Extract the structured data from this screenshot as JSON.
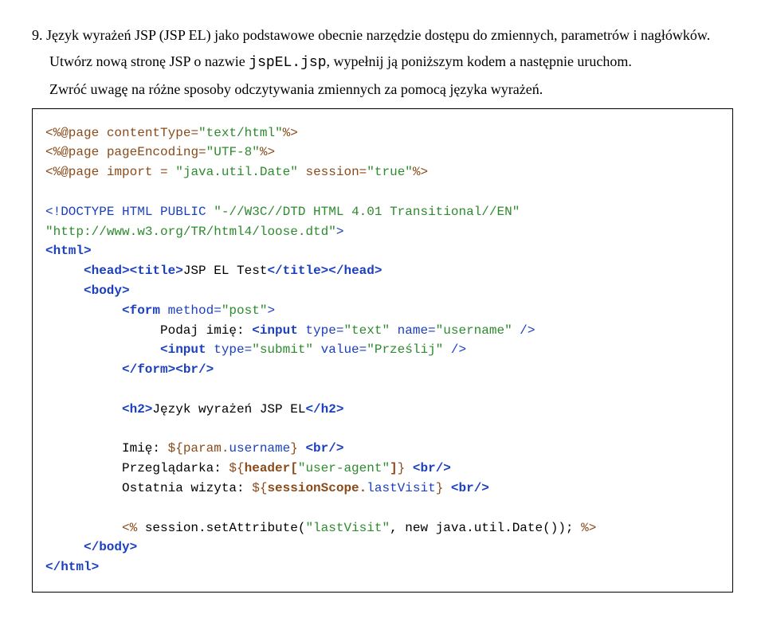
{
  "task": {
    "number": "9.",
    "line1": "Język wyrażeń JSP (JSP EL) jako podstawowe obecnie narzędzie dostępu do zmiennych, parametrów i nagłówków.",
    "line2a": "Utwórz nową stronę JSP o nazwie ",
    "line2_code": "jspEL.jsp",
    "line2b": ", wypełnij ją poniższym kodem a następnie uruchom.",
    "line3": "Zwróć uwagę na różne sposoby odczytywania zmiennych za pomocą języka wyrażeń."
  },
  "code": {
    "p_page": "<%@page",
    "p_ct": " contentType=",
    "v_ct": "\"text/html\"",
    "p_close": "%>",
    "p_enc": " pageEncoding=",
    "v_enc": "\"UTF-8\"",
    "p_imp": " import = ",
    "v_imp": "\"java.util.Date\"",
    "p_ses": " session=",
    "v_ses": "\"true\"",
    "doctype1": "<!DOCTYPE HTML PUBLIC ",
    "doctype_v1": "\"-//W3C//DTD HTML 4.01 Transitional//EN\"",
    "doctype_v2": "\"http://www.w3.org/TR/html4/loose.dtd\"",
    "doctype_close": ">",
    "html_o": "<html>",
    "head_o": "<head><title>",
    "title_txt": "JSP EL Test",
    "head_c": "</title></head>",
    "body_o": "<body>",
    "form_o": "<form",
    "form_attr": " method=",
    "form_val": "\"post\"",
    "form_end": ">",
    "podaj": "Podaj imię: ",
    "input_o": "<input",
    "typeattr": " type=",
    "typetext": "\"text\"",
    "nameattr": " name=",
    "nameval": "\"username\"",
    "selfclose": " />",
    "typesub": "\"submit\"",
    "valattr": " value=",
    "valprz": "\"Prześlij\"",
    "form_c": "</form><br/>",
    "h2_o": "<h2>",
    "h2_txt": "Język wyrażeń JSP EL",
    "h2_c": "</h2>",
    "imie_lbl": "Imię: ",
    "imie_expr": "${param.",
    "imie_user": "username",
    "imie_close": "}",
    "br": " <br/>",
    "przeg_lbl": "Przeglądarka: ",
    "przeg_expr1": "${",
    "przeg_hdr": "header[",
    "przeg_ua": "\"user-agent\"",
    "przeg_hdr2": "]",
    "przeg_close": "}",
    "ost_lbl": "Ostatnia wizyta: ",
    "ost_expr1": "${",
    "ost_scope": "sessionScope.",
    "ost_lv": "lastVisit",
    "ost_close": "}",
    "scr_open": "<% ",
    "scr_body": "session.setAttribute(",
    "scr_str": "\"lastVisit\"",
    "scr_body2": ", new java.util.Date());",
    "scr_close": " %>",
    "body_c": "</body>",
    "html_c": "</html>"
  }
}
